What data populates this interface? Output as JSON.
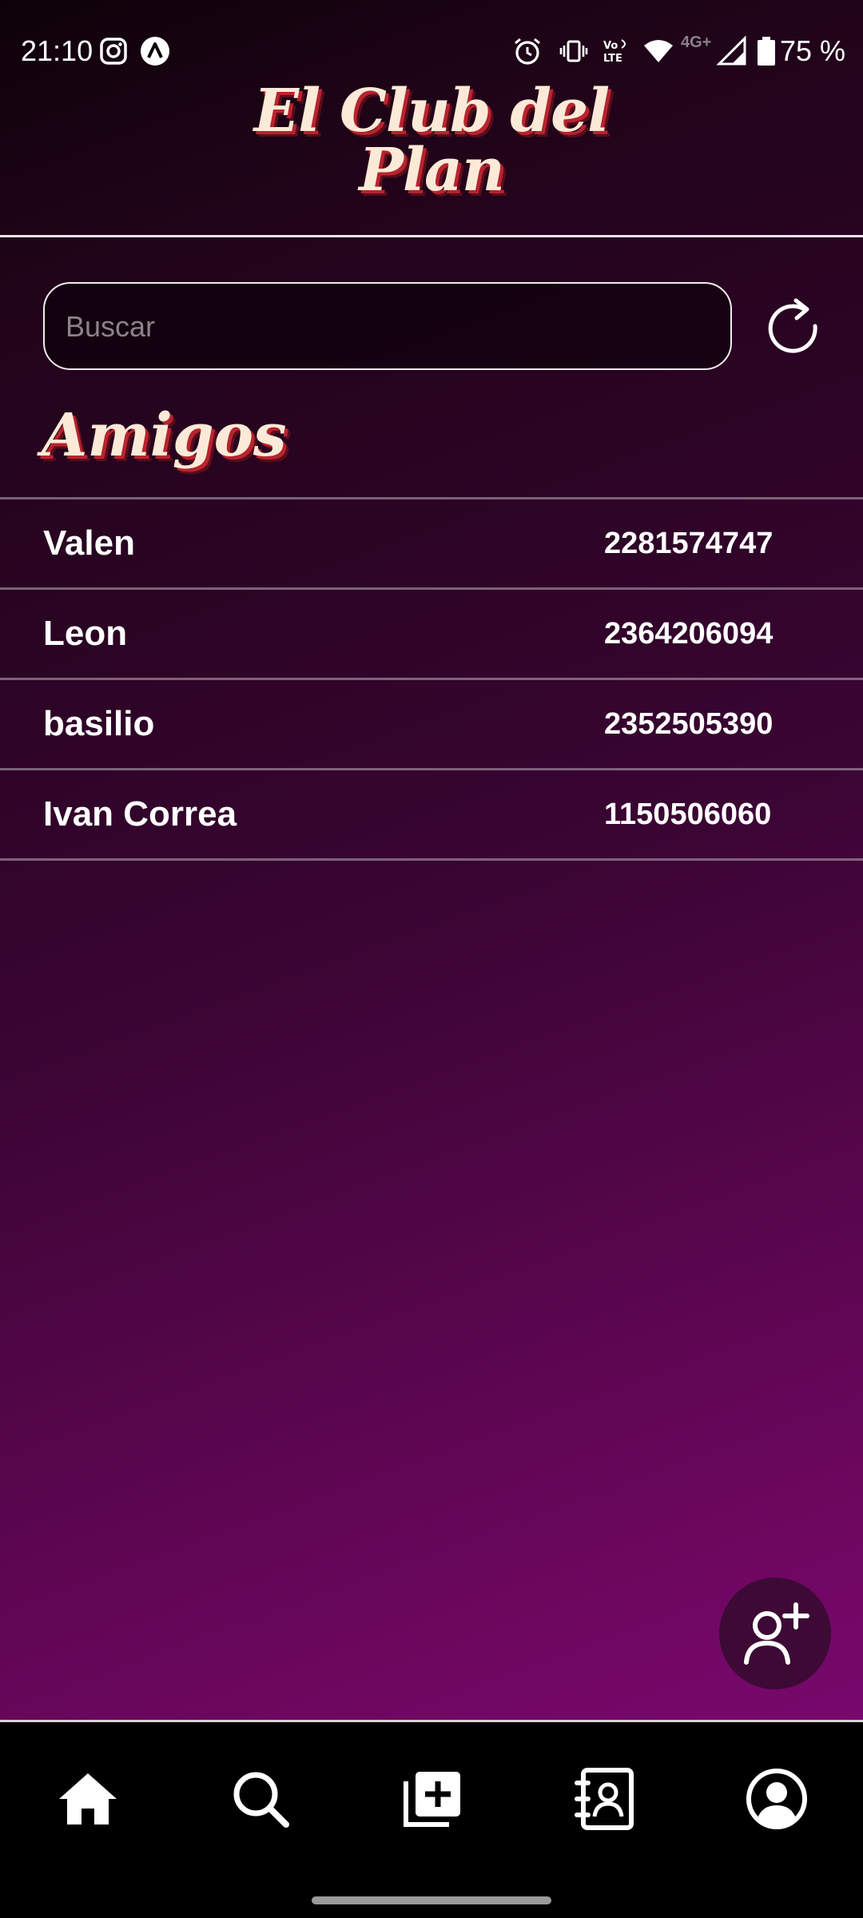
{
  "status_bar": {
    "time": "21:10",
    "network_badge": "4G+",
    "battery": "75 %",
    "icons": [
      "instagram-icon",
      "app-notification-icon",
      "alarm-icon",
      "vibrate-icon",
      "volte-icon",
      "wifi-icon",
      "signal-icon",
      "battery-icon"
    ]
  },
  "header": {
    "logo_line1": "El Club del",
    "logo_line2": "Plan"
  },
  "search": {
    "placeholder": "Buscar",
    "value": ""
  },
  "section": {
    "title": "Amigos"
  },
  "friends": [
    {
      "name": "Valen",
      "phone": "2281574747"
    },
    {
      "name": "Leon",
      "phone": "2364206094"
    },
    {
      "name": "basilio",
      "phone": "2352505390"
    },
    {
      "name": "Ivan Correa",
      "phone": "1150506060"
    }
  ],
  "nav": {
    "items": [
      "home-icon",
      "search-icon",
      "add-plan-icon",
      "contacts-icon",
      "profile-icon"
    ]
  },
  "colors": {
    "accent_text": "#fbead7",
    "accent_shadow": "#b8232f",
    "fab_bg": "#3d0a35"
  }
}
